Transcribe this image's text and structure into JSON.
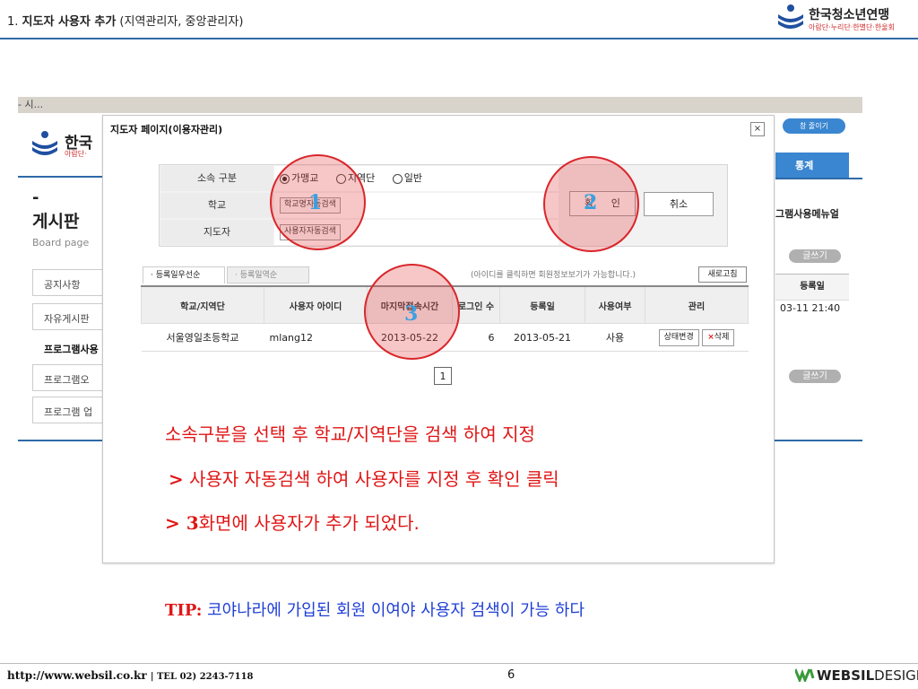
{
  "slide": {
    "title_prefix": "1. ",
    "title_bold": "지도자 사용자 추가",
    "title_suffix": " (지역관리자, 중앙관리자)",
    "org_logo_main": "한국청소년연맹",
    "org_logo_sub": "아람단·누리단·한별단·한울회",
    "page_number": "6",
    "footer_url": "http://www.websil.co.kr",
    "footer_tel": "| TEL 02) 2243-7118",
    "footer_brand_bold": "WEBSIL",
    "footer_brand_light": "DESIGN"
  },
  "background_site": {
    "breadcrumb": "- 시...",
    "logo_text": "한국",
    "logo_sub": "아람단·",
    "dash": "-",
    "board_title": "게시판",
    "board_sub": "Board page",
    "menu": [
      "공지사항",
      "자유게시판",
      "프로그램사용",
      "프로그램오",
      "프로그램 업"
    ],
    "shrink_button": "창 줄이기",
    "stats_tab": "통계",
    "manual_label": "그램사용메뉴얼",
    "write_button": "글쓰기",
    "reg_header": "등록일",
    "reg_value": "03-11 21:40"
  },
  "modal": {
    "title": "지도자 페이지(이용자관리)",
    "close": "×",
    "filter": {
      "affiliation_label": "소속 구분",
      "options": [
        "가맹교",
        "지역단",
        "일반"
      ],
      "selected": "가맹교",
      "school_label": "학교",
      "school_search_btn": "학교명자동검색",
      "leader_label": "지도자",
      "user_search_btn": "사용자자동검색",
      "confirm": "확 인",
      "cancel": "취소"
    },
    "tabs": [
      "· 등록일우선순",
      "· 등록일역순"
    ],
    "hint": "(아이디를 클릭하면 회원정보보기가 가능합니다.)",
    "refresh": "새로고침",
    "table": {
      "headers": [
        "학교/지역단",
        "사용자 아이디",
        "마지막접속시간",
        "로그인 수",
        "등록일",
        "사용여부",
        "관리"
      ],
      "rows": [
        {
          "school": "서울영일초등학교",
          "user_id": "mlang12",
          "last_access": "2013-05-22",
          "login_count": "6",
          "reg_date": "2013-05-21",
          "status": "사용",
          "change_btn": "상태변경",
          "delete_btn": "삭제"
        }
      ]
    },
    "page": "1"
  },
  "annotations": {
    "step1": "1",
    "step2": "2",
    "step3": "3",
    "circle_color": "#d9262b",
    "number_color": "#3aa0e0"
  },
  "instructions": {
    "line1": "소속구분을 선택 후 학교/지역단을 검색 하여 지정",
    "line2_prefix": ">",
    "line2": " 사용자 자동검색 하여 사용자를 지정 후 확인 클릭",
    "line3_prefix": "> 3",
    "line3": "화면에 사용자가 추가 되었다.",
    "tip_label": "TIP:",
    "tip_text": " 코야나라에  가입된 회원 이여야  사용자 검색이 가능 하다"
  },
  "colors": {
    "accent_blue": "#2e6aa8",
    "instruction_red": "#e01515",
    "tip_blue": "#1f3fd6"
  }
}
